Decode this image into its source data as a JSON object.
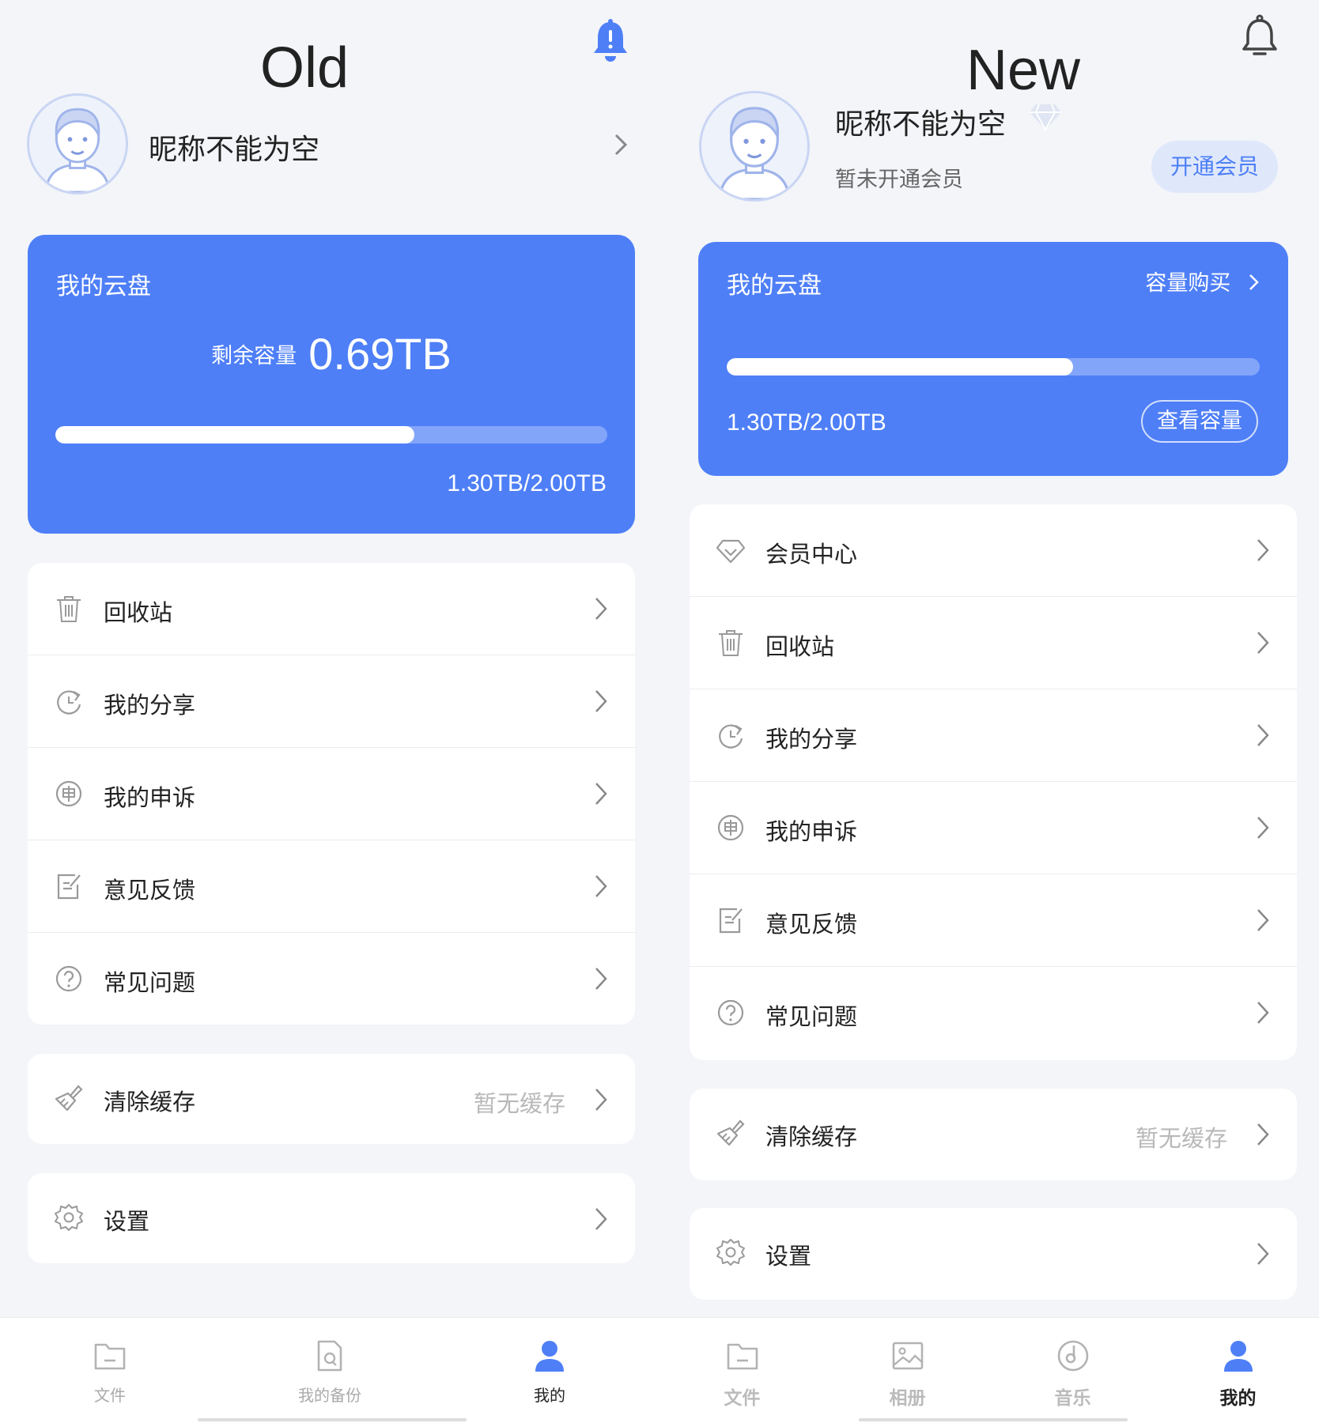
{
  "old": {
    "title": "Old",
    "nickname": "昵称不能为空",
    "card": {
      "title": "我的云盘",
      "remaining_label": "剩余容量",
      "remaining_value": "0.69TB",
      "usage": "1.30TB/2.00TB",
      "usage_fraction": 0.65
    },
    "menu": [
      {
        "label": "回收站",
        "icon": "trash-icon"
      },
      {
        "label": "我的分享",
        "icon": "share-icon"
      },
      {
        "label": "我的申诉",
        "icon": "appeal-icon"
      },
      {
        "label": "意见反馈",
        "icon": "feedback-icon"
      },
      {
        "label": "常见问题",
        "icon": "help-icon"
      }
    ],
    "cache": {
      "label": "清除缓存",
      "value": "暂无缓存",
      "icon": "broom-icon"
    },
    "settings": {
      "label": "设置",
      "icon": "gear-icon"
    },
    "tabs": [
      {
        "label": "文件",
        "icon": "folder-icon"
      },
      {
        "label": "我的备份",
        "icon": "backup-icon"
      },
      {
        "label": "我的",
        "icon": "person-icon",
        "active": true
      }
    ]
  },
  "new": {
    "title": "New",
    "nickname": "昵称不能为空",
    "member_status": "暂未开通会员",
    "open_member": "开通会员",
    "card": {
      "title": "我的云盘",
      "buy": "容量购买",
      "usage": "1.30TB/2.00TB",
      "check": "查看容量",
      "usage_fraction": 0.65
    },
    "menu": [
      {
        "label": "会员中心",
        "icon": "diamond-icon"
      },
      {
        "label": "回收站",
        "icon": "trash-icon"
      },
      {
        "label": "我的分享",
        "icon": "share-icon"
      },
      {
        "label": "我的申诉",
        "icon": "appeal-icon"
      },
      {
        "label": "意见反馈",
        "icon": "feedback-icon"
      },
      {
        "label": "常见问题",
        "icon": "help-icon"
      }
    ],
    "cache": {
      "label": "清除缓存",
      "value": "暂无缓存",
      "icon": "broom-icon"
    },
    "settings": {
      "label": "设置",
      "icon": "gear-icon"
    },
    "tabs": [
      {
        "label": "文件",
        "icon": "folder-icon"
      },
      {
        "label": "相册",
        "icon": "photo-icon"
      },
      {
        "label": "音乐",
        "icon": "music-icon"
      },
      {
        "label": "我的",
        "icon": "person-icon",
        "active": true
      }
    ]
  },
  "colors": {
    "accent": "#4e7ff7",
    "background": "#f3f5f9",
    "bell_filled": "#4e7ff7"
  }
}
